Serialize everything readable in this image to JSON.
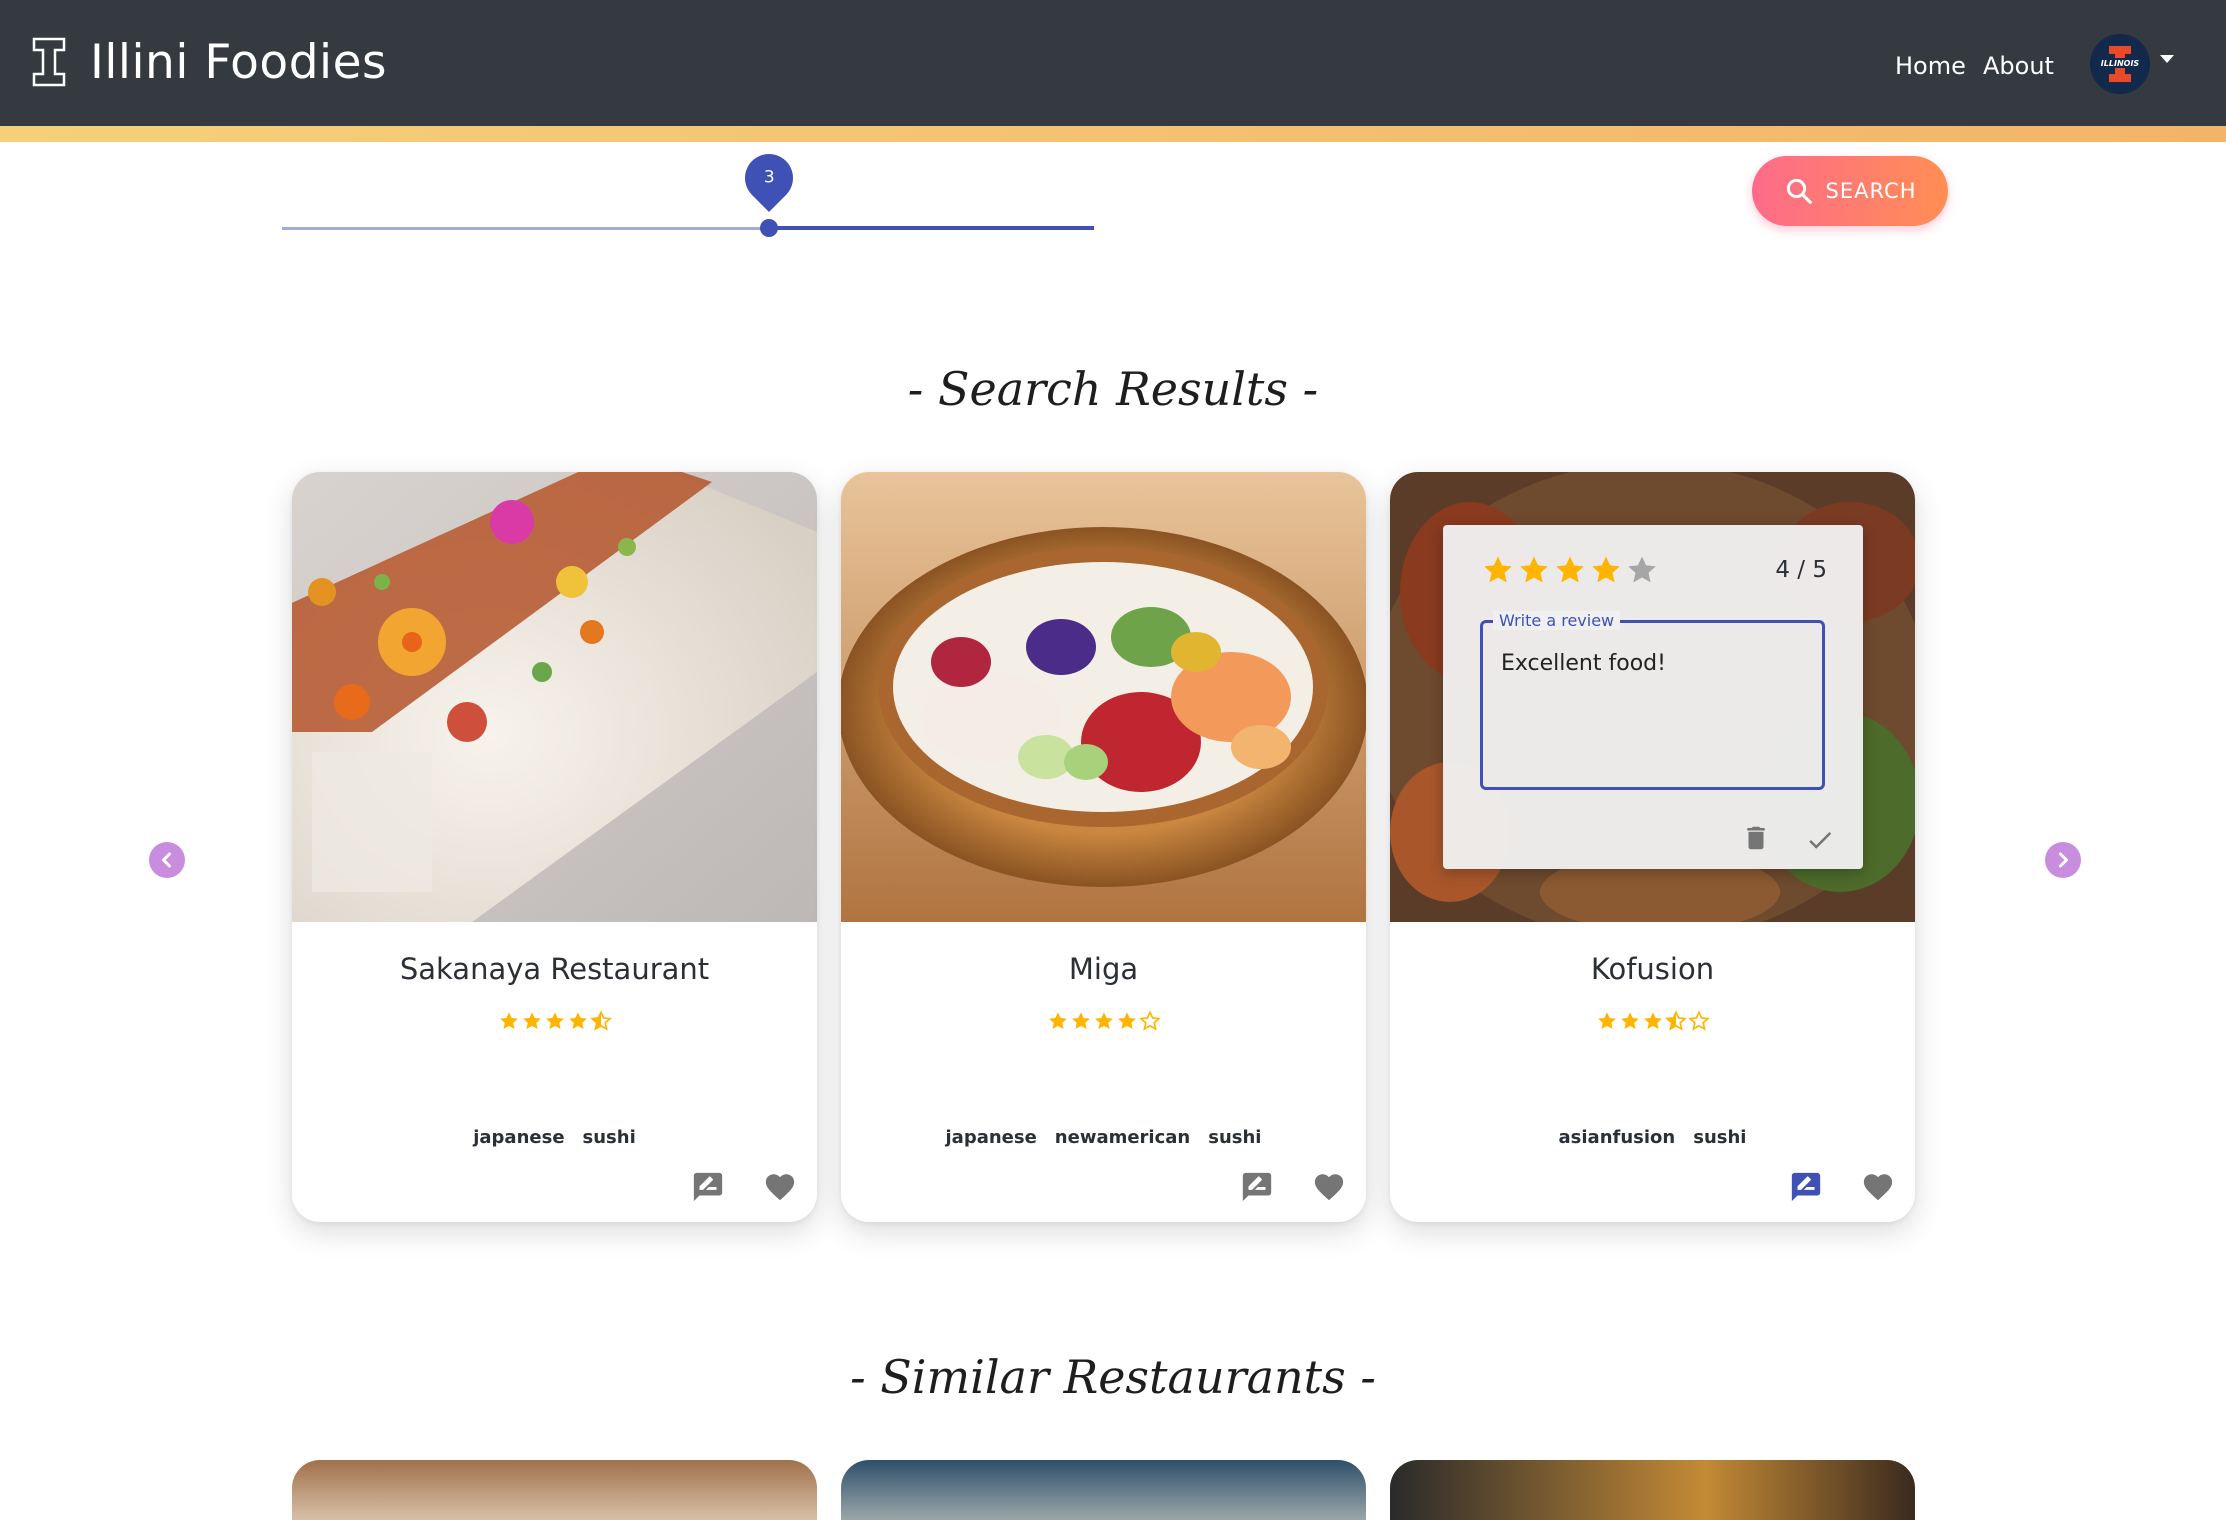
{
  "header": {
    "app_title": "Illini Foodies",
    "nav": [
      {
        "label": "Home"
      },
      {
        "label": "About"
      }
    ],
    "avatar_text": "ILLINOIS"
  },
  "slider": {
    "value": 3,
    "value_label": "3",
    "fill_fraction": 0.6
  },
  "search_button": {
    "label": "SEARCH",
    "icon": "search-icon"
  },
  "sections": {
    "search_results": "- Search Results -",
    "similar": "- Similar Restaurants -"
  },
  "cards": [
    {
      "name": "Sakanaya Restaurant",
      "rating": 4.5,
      "tags": [
        "japanese",
        "sushi"
      ]
    },
    {
      "name": "Miga",
      "rating": 4,
      "tags": [
        "japanese",
        "newamerican",
        "sushi"
      ]
    },
    {
      "name": "Kofusion",
      "rating": 3.5,
      "tags": [
        "asianfusion",
        "sushi"
      ],
      "review_open": true
    }
  ],
  "review": {
    "stars_selected": 4,
    "score_text": "4 / 5",
    "field_label": "Write a review",
    "field_value": "Excellent food!"
  },
  "colors": {
    "header_bg": "#343a40",
    "accent_gold": "#f5d079",
    "primary": "#3f51b5",
    "star": "#ffb400",
    "arrow": "#c98de0"
  }
}
